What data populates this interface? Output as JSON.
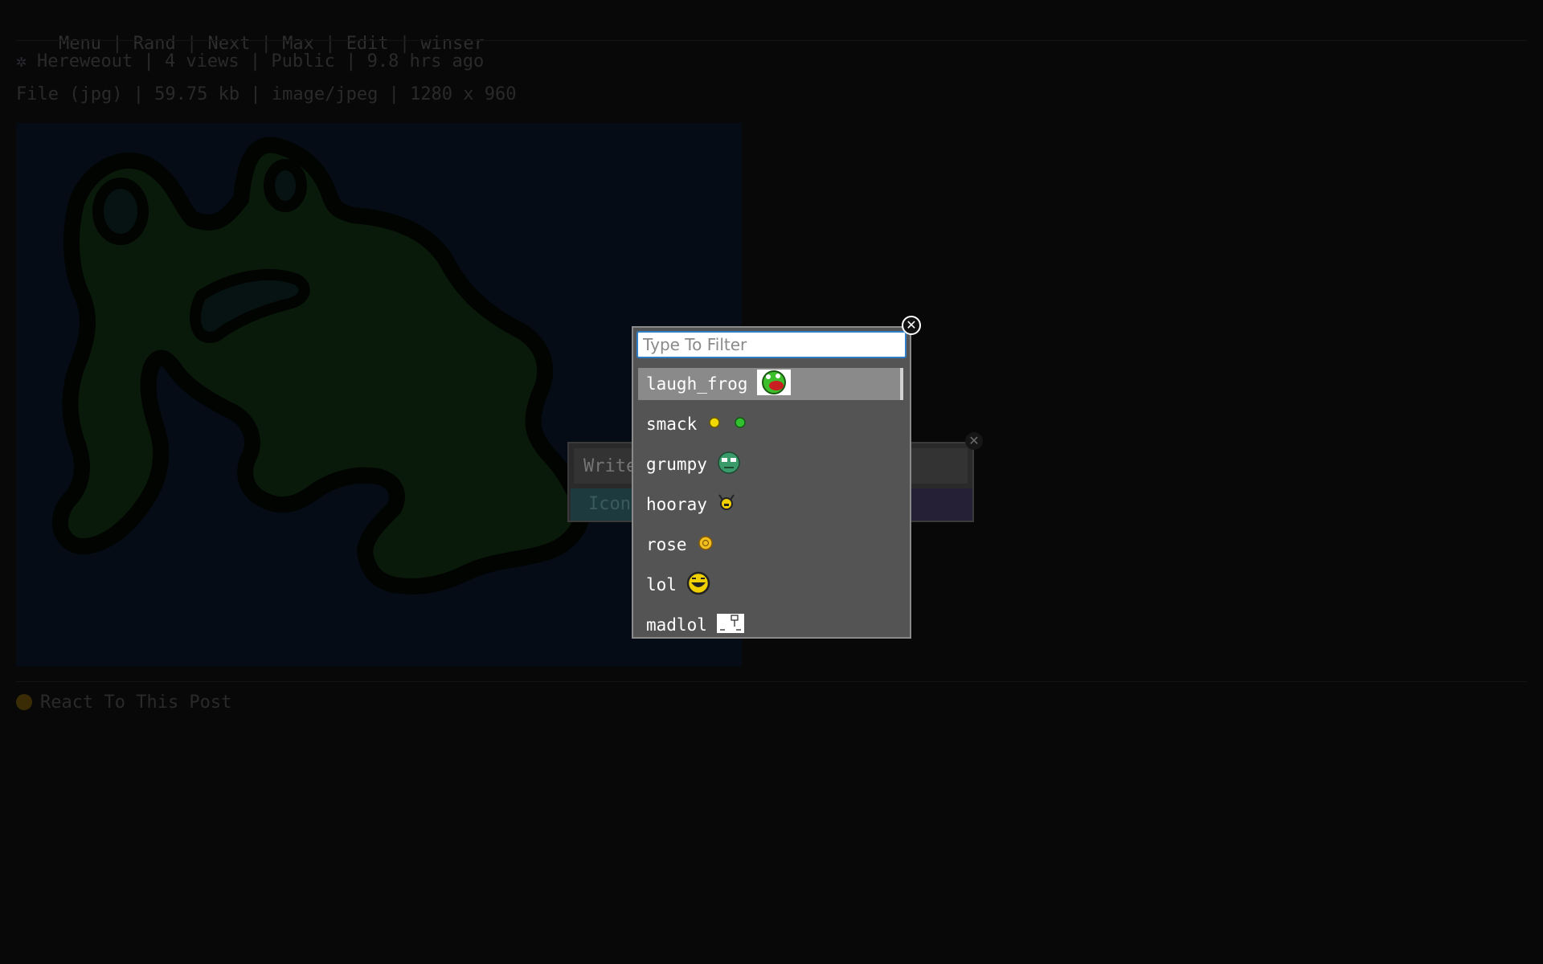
{
  "nav": {
    "items": [
      "Menu",
      "Rand",
      "Next",
      "Max",
      "Edit",
      "winser"
    ],
    "separator": "|"
  },
  "post": {
    "meta_line": "Hereweout | 4 views | Public | 9.8 hrs ago",
    "file_line": "File (jpg) | 59.75 kb | image/jpeg | 1280 x 960",
    "react_label": "React To This Post"
  },
  "comment": {
    "input_placeholder": "Write",
    "icon_button_label": "Icon",
    "close_symbol": "✕"
  },
  "picker": {
    "filter_placeholder": "Type To Filter",
    "close_symbol": "✕",
    "items": [
      {
        "label": "laugh_frog",
        "icon": "laugh-frog-icon",
        "selected": true
      },
      {
        "label": "smack",
        "icon": "smack-icon",
        "selected": false
      },
      {
        "label": "grumpy",
        "icon": "grumpy-icon",
        "selected": false
      },
      {
        "label": "hooray",
        "icon": "hooray-icon",
        "selected": false
      },
      {
        "label": "rose",
        "icon": "rose-icon",
        "selected": false
      },
      {
        "label": "lol",
        "icon": "lol-icon",
        "selected": false
      },
      {
        "label": "madlol",
        "icon": "madlol-icon",
        "selected": false
      }
    ]
  },
  "colors": {
    "picker_bg": "#545454",
    "picker_selected": "#8a8a8a",
    "filter_border": "#2f7dc6",
    "image_bg": "#050c16",
    "blob_fill": "#0a1a0a"
  }
}
